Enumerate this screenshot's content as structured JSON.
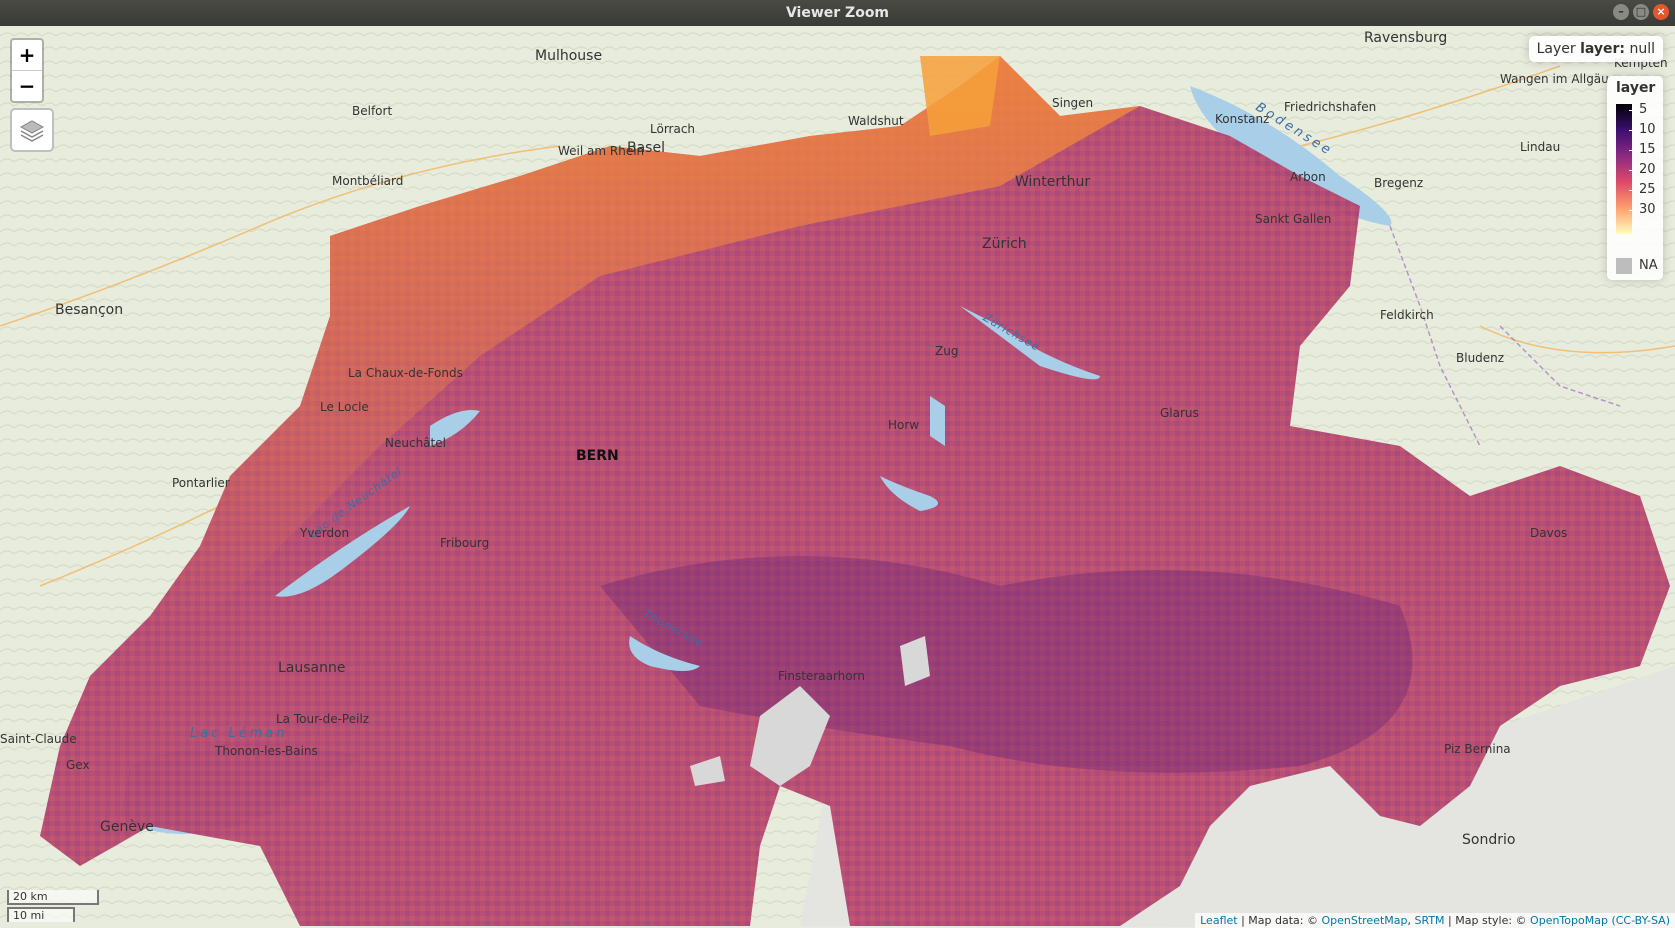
{
  "window": {
    "title": "Viewer Zoom"
  },
  "zoom_in_label": "+",
  "zoom_out_label": "−",
  "info": {
    "prefix": "Layer ",
    "name": "layer:",
    "value": " null"
  },
  "legend": {
    "title": "layer",
    "ticks": [
      "5",
      "10",
      "15",
      "20",
      "25",
      "30"
    ],
    "na_label": "NA",
    "palette": [
      "#000004",
      "#3b0f70",
      "#8c2981",
      "#de4968",
      "#fe9f6d",
      "#fcfdbf"
    ],
    "na_color": "#bdbdbd"
  },
  "scale": {
    "km": "20 km",
    "mi": "10 mi"
  },
  "attribution": {
    "leaflet": "Leaflet",
    "sep1": " | Map data: © ",
    "osm": "OpenStreetMap",
    "sep2": ", ",
    "srtm": "SRTM",
    "sep3": " | Map style: © ",
    "otm": "OpenTopoMap",
    "sep4": " ",
    "license": "(CC-BY-SA)"
  },
  "places": {
    "mulhouse": "Mulhouse",
    "ravensburg": "Ravensburg",
    "besancon": "Besançon",
    "belfort": "Belfort",
    "basel": "Basel",
    "winterthur": "Winterthur",
    "zurich": "Zürich",
    "bern": "BERN",
    "lausanne": "Lausanne",
    "geneve": "Genève",
    "friedrichshafen": "Friedrichshafen",
    "bregenz": "Bregenz",
    "sanktgallen": "Sankt Gallen",
    "montbeliard": "Montbéliard",
    "lorrach": "Lörrach",
    "arbon": "Arbon",
    "feldkirch": "Feldkirch",
    "bludenz": "Bludenz",
    "sondrio": "Sondrio",
    "thonon": "Thonon-les-Bains",
    "latour": "La Tour-de-Peilz",
    "pontarlier": "Pontarlier",
    "lelocle": "Le Locle",
    "lachauxdefonds": "La Chaux-de-Fonds",
    "neuchatel": "Neuchâtel",
    "fribourg": "Fribourg",
    "yverdon": "Yverdon",
    "glarus": "Glarus",
    "zug": "Zug",
    "horw": "Horw",
    "davos": "Davos",
    "finsteraarhorn": "Finsteraarhorn",
    "pizbernina": "Piz Bernina",
    "saintclaude": "Saint-Claude",
    "gex": "Gex",
    "kempten": "Kempten",
    "lindau": "Lindau",
    "wangen": "Wangen im Allgäu",
    "singen": "Singen",
    "konstanz": "Konstanz",
    "waldshut": "Waldshut",
    "weil": "Weil am Rhein",
    "lacleman": "Lac Léman",
    "bodensee": "Bodensee",
    "lacneuchatel": "Lac de Neuchâtel",
    "thunersee": "Thunersee",
    "zurichsee": "Zürichsee"
  }
}
